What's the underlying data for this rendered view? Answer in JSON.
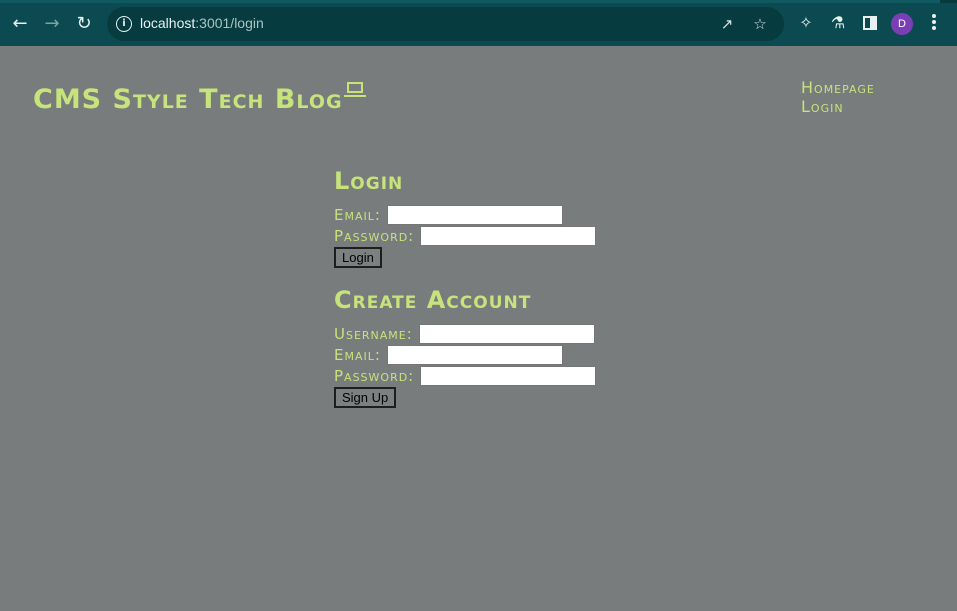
{
  "browser": {
    "url_host": "localhost",
    "url_path": ":3001/login",
    "avatar_letter": "D",
    "icons": [
      "back-arrow-icon",
      "forward-arrow-icon",
      "reload-icon",
      "site-info-icon",
      "share-icon",
      "bookmark-star-icon",
      "extensions-puzzle-icon",
      "labs-flask-icon",
      "side-panel-icon",
      "kebab-menu-icon"
    ]
  },
  "site": {
    "title": "CMS Style Tech Blog",
    "title_icon": "laptop-icon",
    "nav": {
      "homepage": "Homepage",
      "login": "Login"
    }
  },
  "login": {
    "heading": "Login",
    "email_label": "Email:",
    "email_value": "",
    "password_label": "Password:",
    "password_value": "",
    "button_label": "Login"
  },
  "signup": {
    "heading": "Create Account",
    "username_label": "Username:",
    "username_value": "",
    "email_label": "Email:",
    "email_value": "",
    "password_label": "Password:",
    "password_value": "",
    "button_label": "Sign Up"
  },
  "colors": {
    "accent": "#c6e37c",
    "page_background": "#787c7d",
    "chrome_background": "#0b4a50"
  }
}
